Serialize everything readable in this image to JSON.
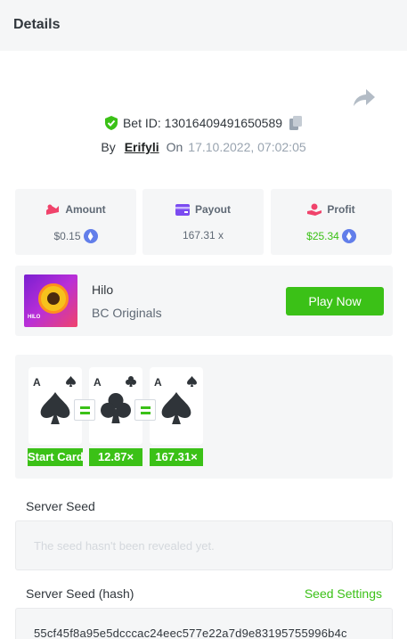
{
  "header": {
    "title": "Details"
  },
  "bet": {
    "id_label": "Bet ID: 13016409491650589",
    "by_label": "By",
    "user": "Erifyli",
    "on_label": "On",
    "date": "17.10.2022, 07:02:05"
  },
  "stats": {
    "amount": {
      "label": "Amount",
      "value": "$0.15"
    },
    "payout": {
      "label": "Payout",
      "value": "167.31 x"
    },
    "profit": {
      "label": "Profit",
      "value": "$25.34"
    }
  },
  "game": {
    "name": "Hilo",
    "provider": "BC Originals",
    "thumb_tag": "HILO",
    "play_label": "Play Now"
  },
  "cards": [
    {
      "rank": "A",
      "suit": "spade",
      "multiplier": "Start Card"
    },
    {
      "rank": "A",
      "suit": "club",
      "multiplier": "12.87×"
    },
    {
      "rank": "A",
      "suit": "spade",
      "multiplier": "167.31×"
    }
  ],
  "seeds": {
    "server_seed_label": "Server Seed",
    "server_seed_placeholder": "The seed hasn't been revealed yet.",
    "hash_label": "Server Seed (hash)",
    "settings_label": "Seed Settings",
    "hash_value": "55cf45f8a95e5dcccac24eec577e22a7d9e83195755996b4c"
  },
  "colors": {
    "accent": "#3bc117",
    "panel": "#f5f6f7",
    "eth": "#627eea"
  },
  "icons": [
    "share-icon",
    "shield-check-icon",
    "copy-icon",
    "amount-icon",
    "payout-icon",
    "profit-icon",
    "eth-icon",
    "spade-icon",
    "club-icon"
  ]
}
